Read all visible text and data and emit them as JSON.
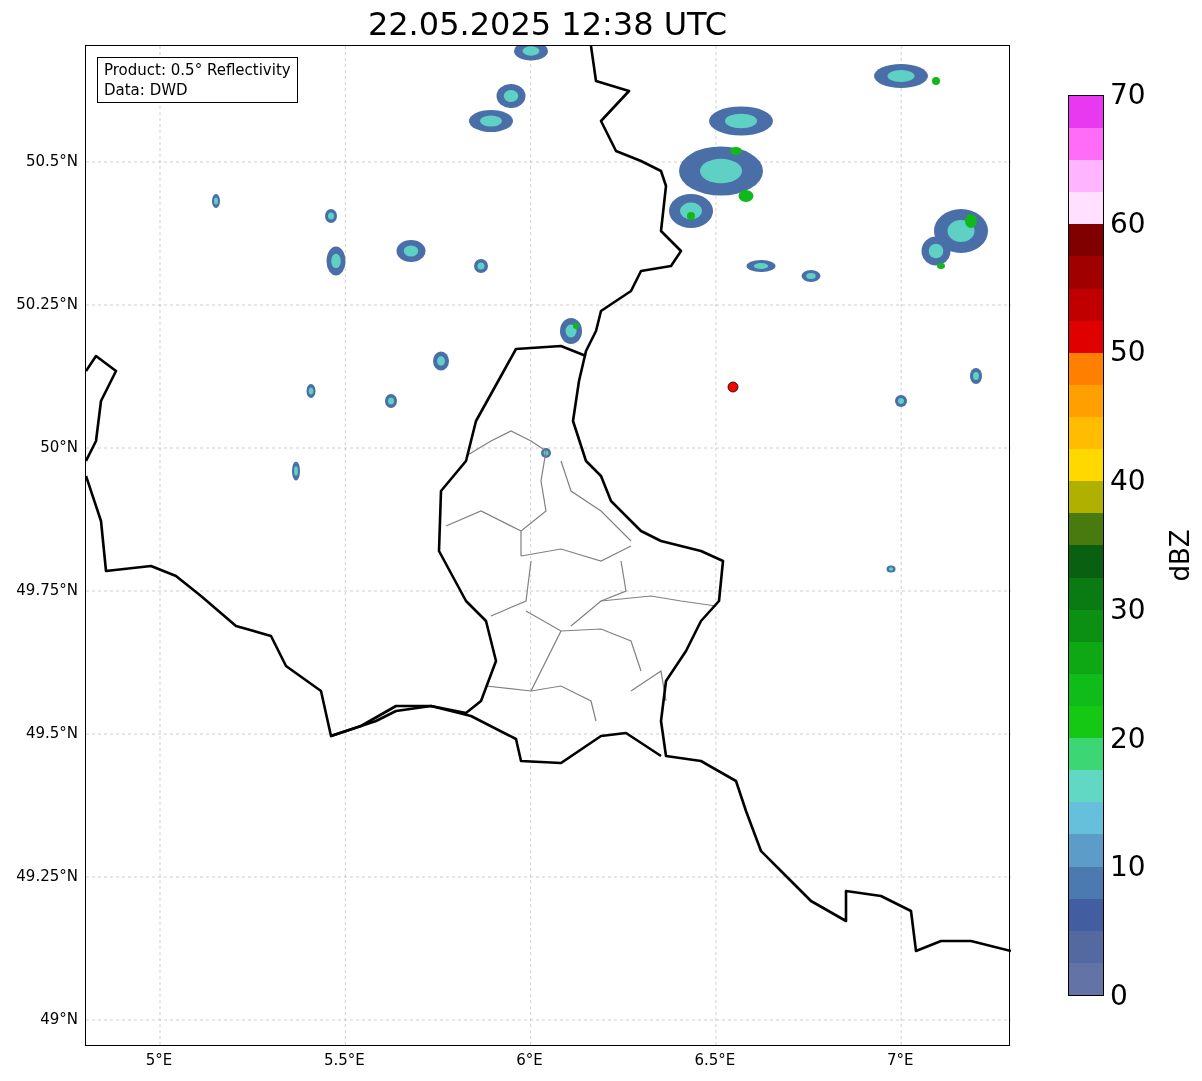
{
  "title": "22.05.2025 12:38 UTC",
  "legend": {
    "lines": [
      "Product: 0.5° Reflectivity",
      "Data: DWD"
    ]
  },
  "map": {
    "lat_labels": [
      "50.5°N",
      "50.25°N",
      "50°N",
      "49.75°N",
      "49.5°N",
      "49.25°N",
      "49°N"
    ],
    "lon_labels": [
      "5°E",
      "5.5°E",
      "6°E",
      "6.5°E",
      "7°E"
    ]
  },
  "colorbar": {
    "label": "dBZ",
    "ticks": [
      "70",
      "60",
      "50",
      "40",
      "30",
      "20",
      "10",
      "0"
    ],
    "bins": [
      {
        "color": "#6473a6"
      },
      {
        "color": "#5469a0"
      },
      {
        "color": "#425ea0"
      },
      {
        "color": "#4a7ab0"
      },
      {
        "color": "#5b9dc8"
      },
      {
        "color": "#66c0dc"
      },
      {
        "color": "#60d8c4"
      },
      {
        "color": "#3cd674"
      },
      {
        "color": "#14c814"
      },
      {
        "color": "#10bc1a"
      },
      {
        "color": "#0ea815"
      },
      {
        "color": "#0c9014"
      },
      {
        "color": "#0a7a12"
      },
      {
        "color": "#086010"
      },
      {
        "color": "#487a10"
      },
      {
        "color": "#b0b000"
      },
      {
        "color": "#ffd800"
      },
      {
        "color": "#ffbc00"
      },
      {
        "color": "#ffa000"
      },
      {
        "color": "#ff8000"
      },
      {
        "color": "#e00000"
      },
      {
        "color": "#c00000"
      },
      {
        "color": "#a00000"
      },
      {
        "color": "#800000"
      },
      {
        "color": "#ffe0ff"
      },
      {
        "color": "#ffb4ff"
      },
      {
        "color": "#ff6cf8"
      },
      {
        "color": "#e838f0"
      }
    ]
  }
}
